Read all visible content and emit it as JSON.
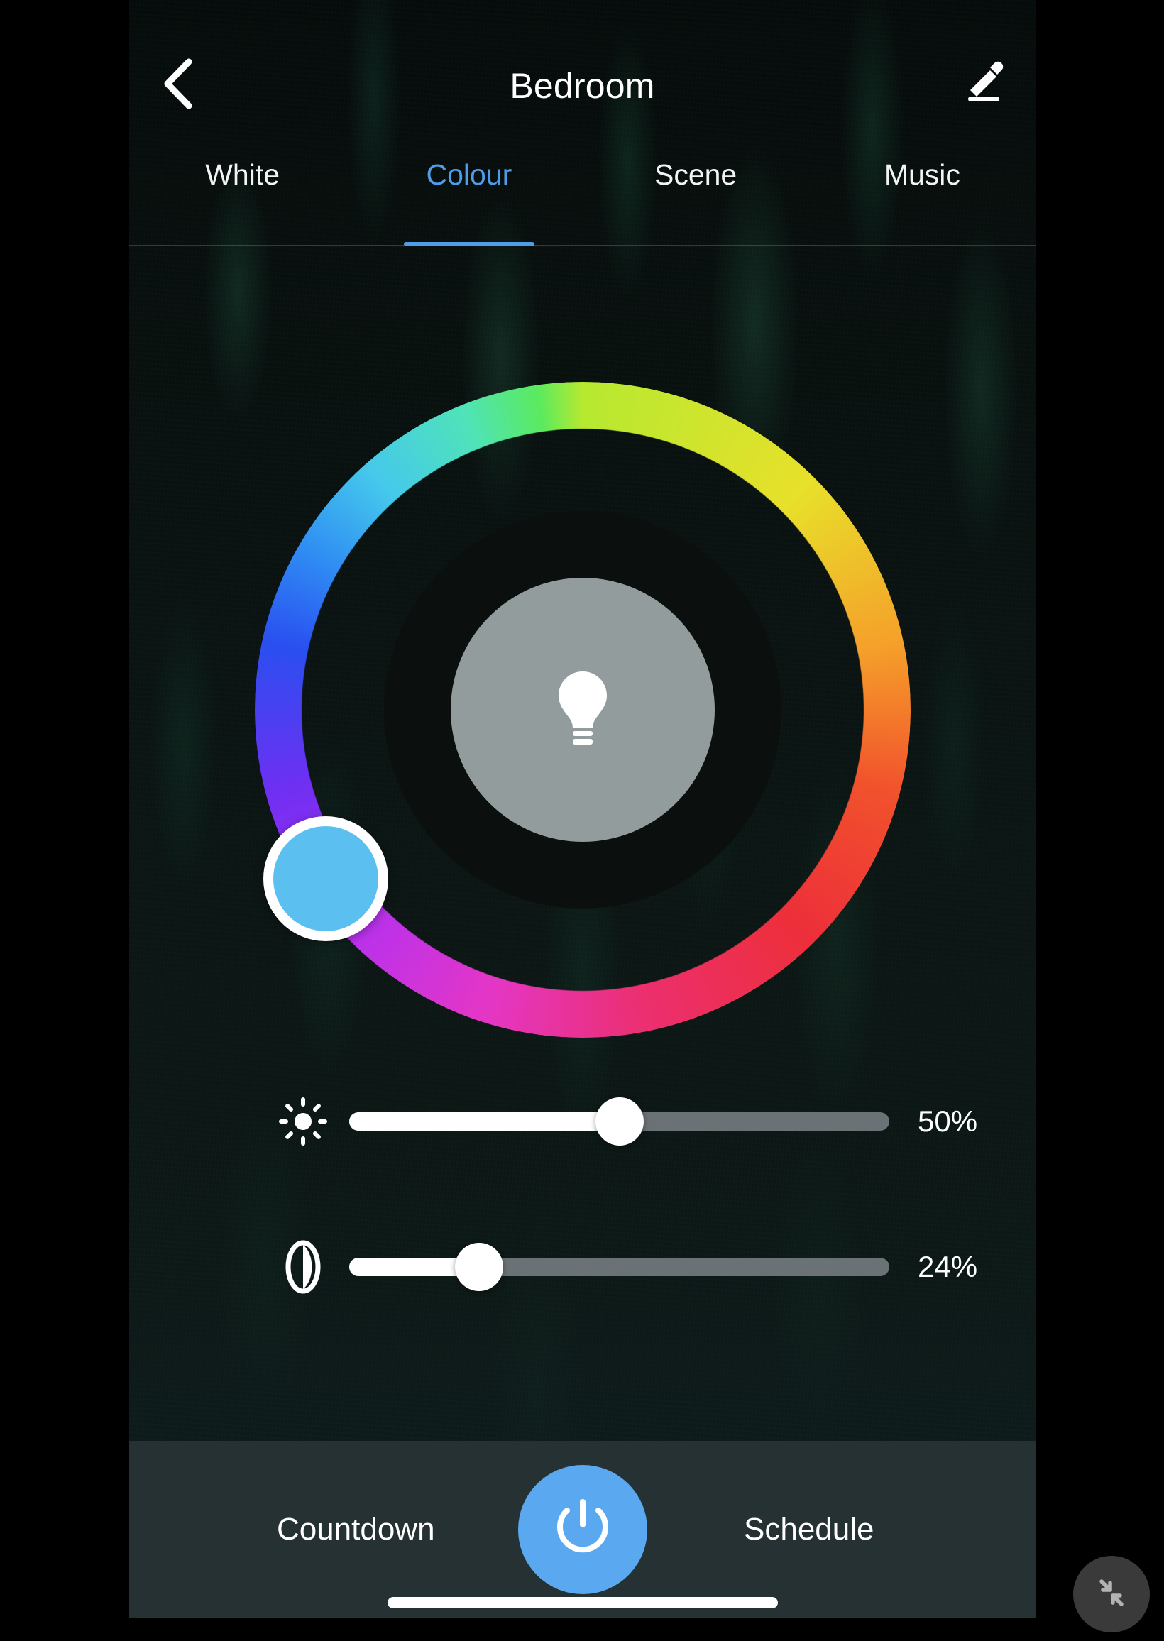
{
  "header": {
    "title": "Bedroom",
    "back_icon": "chevron-left-icon",
    "edit_icon": "pencil-edit-icon"
  },
  "tabs": [
    {
      "label": "White",
      "active": false
    },
    {
      "label": "Colour",
      "active": true
    },
    {
      "label": "Scene",
      "active": false
    },
    {
      "label": "Music",
      "active": false
    }
  ],
  "colour_picker": {
    "bulb_icon": "light-bulb-icon",
    "selected_colour": "#5bbff0",
    "handle_angle_deg": 200
  },
  "sliders": [
    {
      "name": "brightness",
      "icon": "brightness-sun-icon",
      "value": 50,
      "value_label": "50%"
    },
    {
      "name": "saturation",
      "icon": "contrast-half-circle-icon",
      "value": 24,
      "value_label": "24%"
    }
  ],
  "bottom_bar": {
    "countdown_label": "Countdown",
    "schedule_label": "Schedule",
    "power_icon": "power-icon",
    "power_colour": "#5aa8ef"
  },
  "floating_button": {
    "icon": "collapse-arrows-icon"
  },
  "colors": {
    "accent": "#4f9de8",
    "power": "#5aa8ef",
    "bottom_bar_bg": "#263134",
    "slider_inactive": "#6b7275",
    "slider_active": "#ffffff",
    "text": "#ffffff"
  }
}
